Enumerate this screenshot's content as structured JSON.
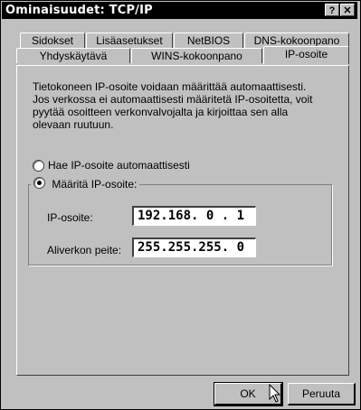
{
  "window": {
    "title": "Ominaisuudet: TCP/IP",
    "help_label": "?",
    "close_label": "✕"
  },
  "tabs": {
    "row1": [
      "Sidokset",
      "Lisäasetukset",
      "NetBIOS",
      "DNS-kokoonpano"
    ],
    "row2": [
      "Yhdyskäytävä",
      "WINS-kokoonpano",
      "IP-osoite"
    ],
    "active": "IP-osoite"
  },
  "description": "Tietokoneen IP-osoite voidaan määrittää automaattisesti. Jos verkossa ei automaattisesti määritetä IP-osoitetta, voit pyytää osoitteen verkonvalvojalta ja kirjoittaa sen alla olevaan ruutuun.",
  "options": {
    "auto": {
      "label": "Hae IP-osoite automaattisesti",
      "selected": false
    },
    "manual": {
      "label": "Määritä IP-osoite:",
      "selected": true
    }
  },
  "fields": {
    "ip": {
      "label": "IP-osoite:",
      "value": "192.168. 0 . 1"
    },
    "subnet": {
      "label": "Aliverkon peite:",
      "value": "255.255.255. 0"
    }
  },
  "buttons": {
    "ok": "OK",
    "cancel": "Peruuta"
  }
}
